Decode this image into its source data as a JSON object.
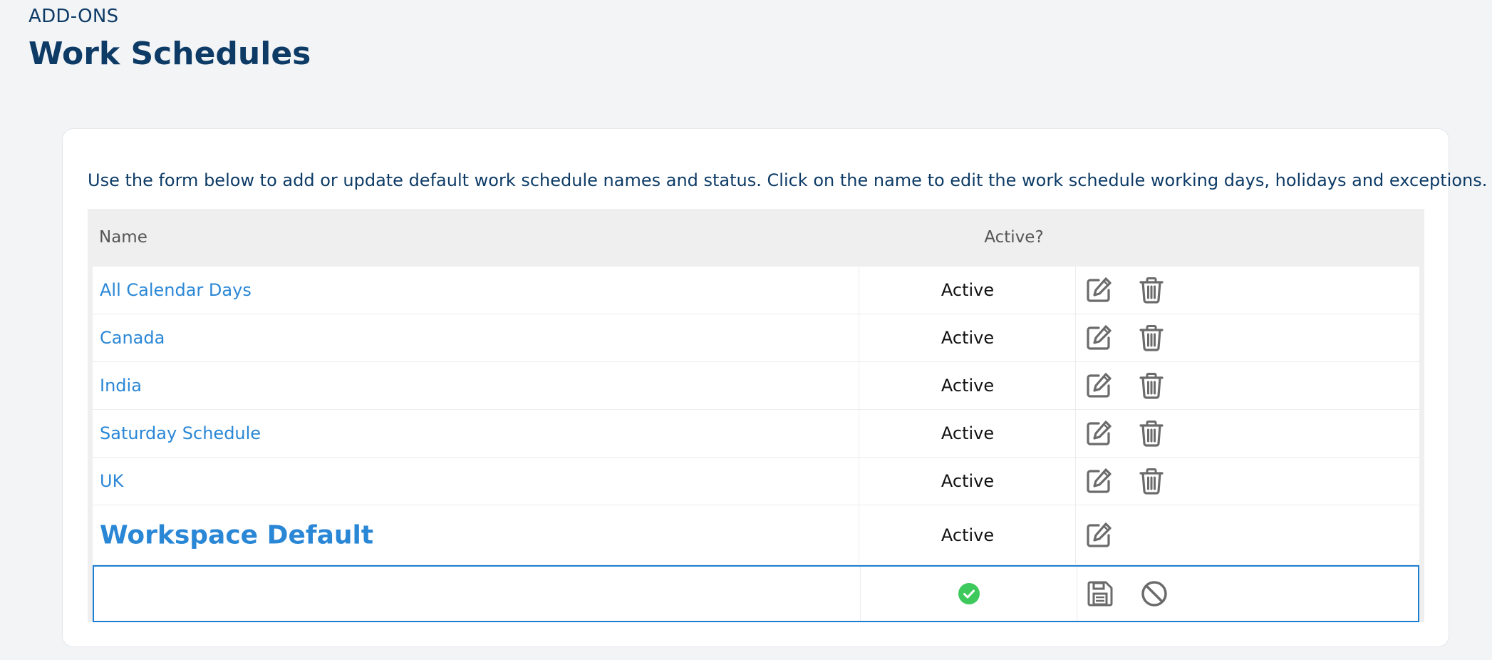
{
  "header": {
    "section_label": "ADD-ONS",
    "title": "Work Schedules"
  },
  "intro_text": "Use the form below to add or update default work schedule names and status. Click on the name to edit the work schedule working days, holidays and exceptions.",
  "table": {
    "columns": {
      "name": "Name",
      "active": "Active?"
    },
    "rows": [
      {
        "name": "All Calendar Days",
        "status": "Active",
        "can_delete": true
      },
      {
        "name": "Canada",
        "status": "Active",
        "can_delete": true
      },
      {
        "name": "India",
        "status": "Active",
        "can_delete": true
      },
      {
        "name": "Saturday Schedule",
        "status": "Active",
        "can_delete": true
      },
      {
        "name": "UK",
        "status": "Active",
        "can_delete": true
      },
      {
        "name": "Workspace Default",
        "status": "Active",
        "can_delete": false
      }
    ],
    "new_row": {
      "name_value": "",
      "active_checked": true
    }
  },
  "icons": {
    "edit": "edit-icon",
    "delete": "trash-icon",
    "save": "save-icon",
    "cancel": "cancel-icon",
    "active_check": "check-circle-icon"
  },
  "colors": {
    "title": "#0d3b66",
    "link": "#2a87d6",
    "icon": "#6b6b6b",
    "active_check": "#3ec95c",
    "new_row_border": "#1d7fd4"
  }
}
